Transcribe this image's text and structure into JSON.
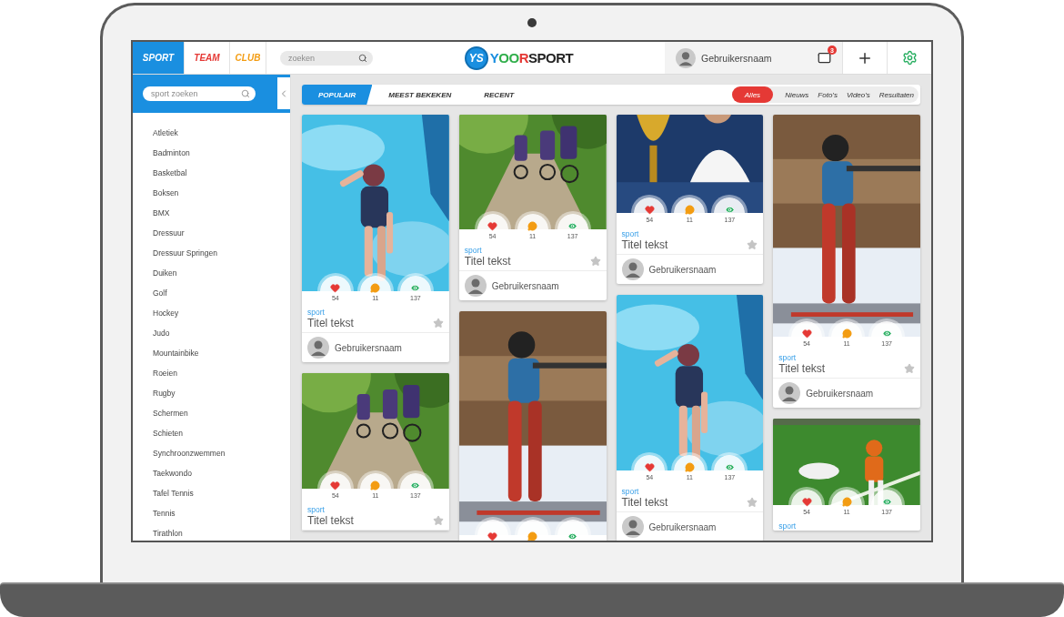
{
  "header": {
    "tabs": [
      {
        "label": "SPORT",
        "selected": true,
        "color": "#1a8fe0"
      },
      {
        "label": "TEAM",
        "selected": false,
        "color": "#e53935"
      },
      {
        "label": "CLUB",
        "selected": false,
        "color": "#f39c12"
      }
    ],
    "search": {
      "placeholder": "zoeken"
    },
    "logo": {
      "mark": "YS",
      "word": [
        {
          "text": "Y",
          "color": "#1a8fe0"
        },
        {
          "text": "OO",
          "color": "#2fae4a"
        },
        {
          "text": "R",
          "color": "#e53935"
        },
        {
          "text": "SPORT",
          "color": "#222222"
        }
      ]
    },
    "user": {
      "name": "Gebruikersnaam"
    },
    "mail": {
      "badge": "3"
    }
  },
  "sidebar": {
    "search": {
      "placeholder": "sport zoeken"
    },
    "items": [
      "Atletiek",
      "Badminton",
      "Basketbal",
      "Boksen",
      "BMX",
      "Dressuur",
      "Dressuur Springen",
      "Duiken",
      "Golf",
      "Hockey",
      "Judo",
      "Mountainbike",
      "Roeien",
      "Rugby",
      "Schermen",
      "Schieten",
      "Synchroonzwemmen",
      "Taekwondo",
      "Tafel Tennis",
      "Tennis",
      "Tirathlon"
    ]
  },
  "filter_bar": {
    "tabs": [
      {
        "label": "POPULAIR",
        "selected": true
      },
      {
        "label": "MEEST BEKEKEN",
        "selected": false
      },
      {
        "label": "RECENT",
        "selected": false
      }
    ],
    "types": [
      {
        "label": "Alles",
        "selected": true
      },
      {
        "label": "Nieuws",
        "selected": false
      },
      {
        "label": "Foto's",
        "selected": false
      },
      {
        "label": "Video's",
        "selected": false
      },
      {
        "label": "Resultaten",
        "selected": false
      }
    ]
  },
  "card_columns": [
    {
      "cards": [
        {
          "kind": "picture",
          "stats": [
            {
              "kind": "likes",
              "count": "54"
            },
            {
              "kind": "comments",
              "count": "11"
            },
            {
              "kind": "views",
              "count": "137"
            }
          ],
          "category": "sport",
          "title": "Titel tekst",
          "user": "Gebruikersnaam"
        },
        {
          "kind": "picture",
          "stats": [
            {
              "kind": "likes",
              "count": "54"
            },
            {
              "kind": "comments",
              "count": "11"
            },
            {
              "kind": "views",
              "count": "137"
            }
          ],
          "category": "sport",
          "title": "Titel tekst"
        }
      ]
    },
    {
      "cards": [
        {
          "kind": "picture",
          "stats": [
            {
              "kind": "likes",
              "count": "54"
            },
            {
              "kind": "comments",
              "count": "11"
            },
            {
              "kind": "views",
              "count": "137"
            }
          ],
          "category": "sport",
          "title": "Titel tekst",
          "user": "Gebruikersnaam"
        },
        {
          "kind": "picture",
          "stats": [
            {
              "kind": "likes"
            },
            {
              "kind": "comments"
            },
            {
              "kind": "views"
            }
          ]
        }
      ]
    },
    {
      "cards": [
        {
          "kind": "picture",
          "stats": [
            {
              "kind": "likes",
              "count": "54"
            },
            {
              "kind": "comments",
              "count": "11"
            },
            {
              "kind": "views",
              "count": "137"
            }
          ],
          "category": "sport",
          "title": "Titel tekst",
          "user": "Gebruikersnaam"
        },
        {
          "kind": "picture",
          "stats": [
            {
              "kind": "likes",
              "count": "54"
            },
            {
              "kind": "comments",
              "count": "11"
            },
            {
              "kind": "views",
              "count": "137"
            }
          ],
          "category": "sport",
          "title": "Titel tekst",
          "user": "Gebruikersnaam"
        }
      ]
    },
    {
      "cards": [
        {
          "kind": "picture",
          "stats": [
            {
              "kind": "likes",
              "count": "54"
            },
            {
              "kind": "comments",
              "count": "11"
            },
            {
              "kind": "views",
              "count": "137"
            }
          ],
          "category": "sport",
          "title": "Titel tekst",
          "user": "Gebruikersnaam"
        },
        {
          "kind": "picture",
          "stats": [
            {
              "kind": "likes",
              "count": "54"
            },
            {
              "kind": "comments",
              "count": "11"
            },
            {
              "kind": "views",
              "count": "137"
            }
          ],
          "category": "sport"
        }
      ]
    }
  ]
}
